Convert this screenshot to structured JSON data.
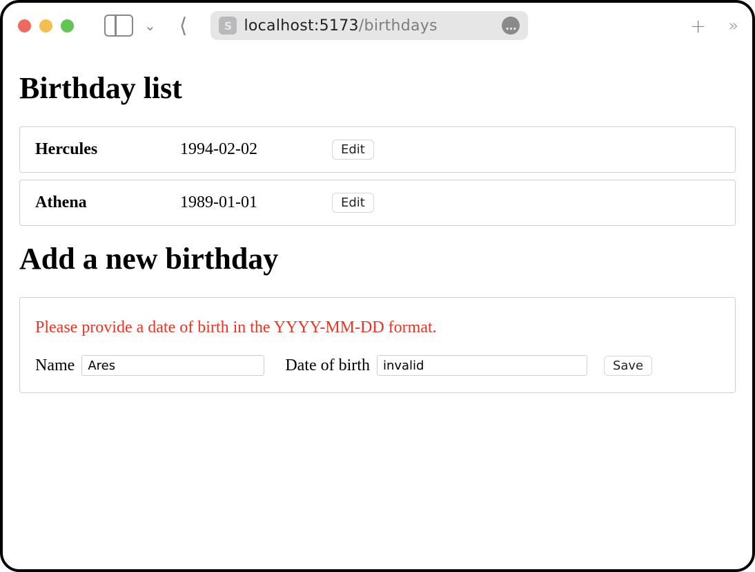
{
  "browser": {
    "url_host": "localhost:5173",
    "url_path": "/birthdays",
    "site_badge": "S"
  },
  "page": {
    "list_heading": "Birthday list",
    "add_heading": "Add a new birthday"
  },
  "birthdays": [
    {
      "name": "Hercules",
      "dob": "1994-02-02",
      "edit_label": "Edit"
    },
    {
      "name": "Athena",
      "dob": "1989-01-01",
      "edit_label": "Edit"
    }
  ],
  "form": {
    "error": "Please provide a date of birth in the YYYY-MM-DD format.",
    "name_label": "Name",
    "name_value": "Ares",
    "dob_label": "Date of birth",
    "dob_value": "invalid",
    "save_label": "Save"
  }
}
